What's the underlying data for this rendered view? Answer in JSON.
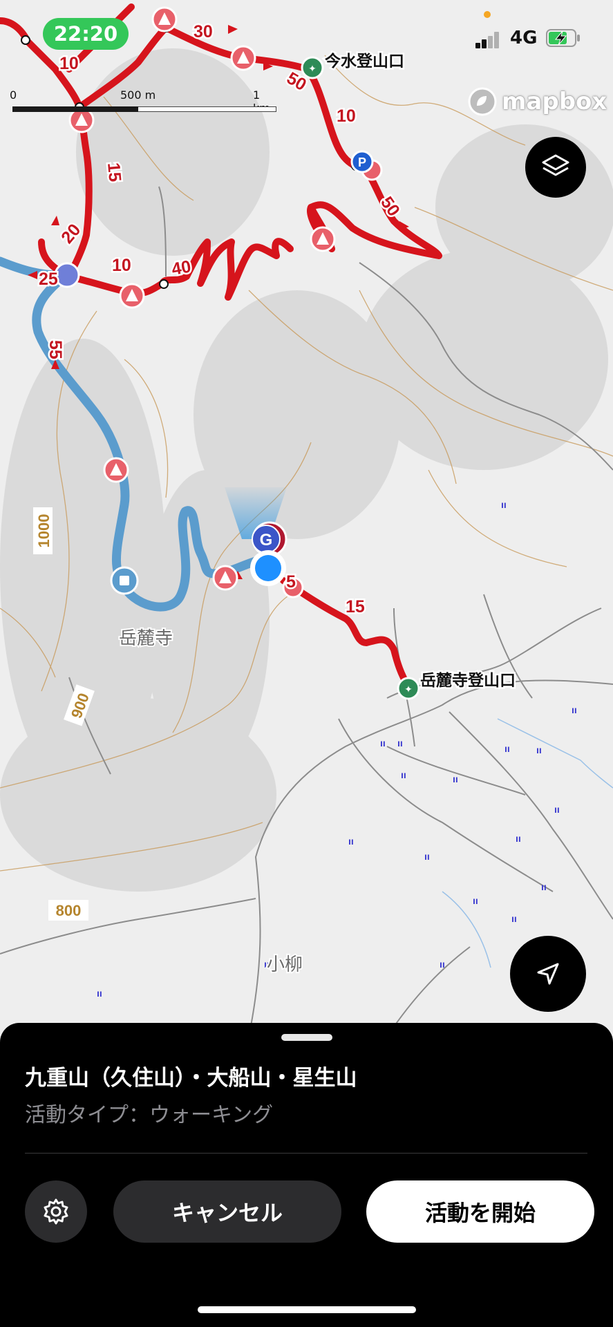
{
  "status_bar": {
    "time": "22:20",
    "network": "4G",
    "colors": {
      "time_pill": "#34c759",
      "battery_fill": "#34c759"
    }
  },
  "map": {
    "scale": {
      "zero": "0",
      "mid": "500 m",
      "end": "1 km"
    },
    "attribution": "mapbox",
    "places": [
      {
        "id": "imamizu",
        "name": "今水登山口"
      },
      {
        "id": "gakurokuji_trailhead",
        "name": "岳麓寺登山口"
      },
      {
        "id": "gakurokuji",
        "name": "岳麓寺"
      },
      {
        "id": "koyanagi",
        "name": "小柳"
      }
    ],
    "elevation_labels": [
      "1000",
      "900",
      "800"
    ],
    "segment_minutes": [
      "10",
      "30",
      "50",
      "10",
      "10",
      "15",
      "20",
      "25",
      "10",
      "40",
      "50",
      "55",
      "15",
      "5"
    ],
    "colors": {
      "route": "#d6141c",
      "alt_route": "#5b9ccd",
      "contour": "#c89a5a",
      "user_location": "#1e90ff"
    },
    "icons": [
      "warning-icon",
      "trailhead-hiker-icon",
      "parking-icon",
      "goal-marker-icon",
      "location-dot-icon"
    ]
  },
  "controls": {
    "layers_icon": "layers-icon",
    "locate_icon": "location-arrow-icon"
  },
  "sheet": {
    "title": "九重山（久住山）・大船山・星生山",
    "subtitle": "活動タイプ：ウォーキング",
    "cancel_label": "キャンセル",
    "start_label": "活動を開始",
    "settings_icon": "gear-icon"
  }
}
